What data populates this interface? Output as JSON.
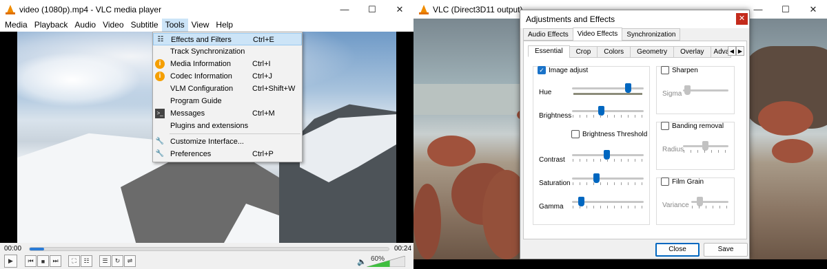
{
  "w1": {
    "title": "video (1080p).mp4 - VLC media player",
    "menu": [
      "Media",
      "Playback",
      "Audio",
      "Video",
      "Subtitle",
      "Tools",
      "View",
      "Help"
    ],
    "tools_menu": [
      {
        "icon": "sliders-icon",
        "label": "Effects and Filters",
        "shortcut": "Ctrl+E"
      },
      {
        "icon": "",
        "label": "Track Synchronization",
        "shortcut": ""
      },
      {
        "icon": "info-icon",
        "label": "Media Information",
        "shortcut": "Ctrl+I"
      },
      {
        "icon": "info-icon",
        "label": "Codec Information",
        "shortcut": "Ctrl+J"
      },
      {
        "icon": "",
        "label": "VLM Configuration",
        "shortcut": "Ctrl+Shift+W"
      },
      {
        "icon": "",
        "label": "Program Guide",
        "shortcut": ""
      },
      {
        "icon": "terminal-icon",
        "label": "Messages",
        "shortcut": "Ctrl+M"
      },
      {
        "icon": "",
        "label": "Plugins and extensions",
        "shortcut": ""
      },
      {
        "icon": "wrench-icon",
        "label": "Customize Interface...",
        "shortcut": ""
      },
      {
        "icon": "wrench-icon",
        "label": "Preferences",
        "shortcut": "Ctrl+P"
      }
    ],
    "elapsed": "00:00",
    "total": "00:24",
    "progress": 0.04,
    "volume": "60%"
  },
  "w2": {
    "title": "VLC (Direct3D11 output)"
  },
  "dialog": {
    "title": "Adjustments and Effects",
    "tabs": [
      "Audio Effects",
      "Video Effects",
      "Synchronization"
    ],
    "subtabs": [
      "Essential",
      "Crop",
      "Colors",
      "Geometry",
      "Overlay",
      "Adva"
    ],
    "image_adjust": "Image adjust",
    "hue": "Hue",
    "brightness": "Brightness",
    "brightness_threshold": "Brightness Threshold",
    "contrast": "Contrast",
    "saturation": "Saturation",
    "gamma": "Gamma",
    "sharpen": "Sharpen",
    "sigma": "Sigma",
    "banding": "Banding removal",
    "radius": "Radius",
    "film_grain": "Film Grain",
    "variance": "Variance",
    "close": "Close",
    "save": "Save"
  }
}
